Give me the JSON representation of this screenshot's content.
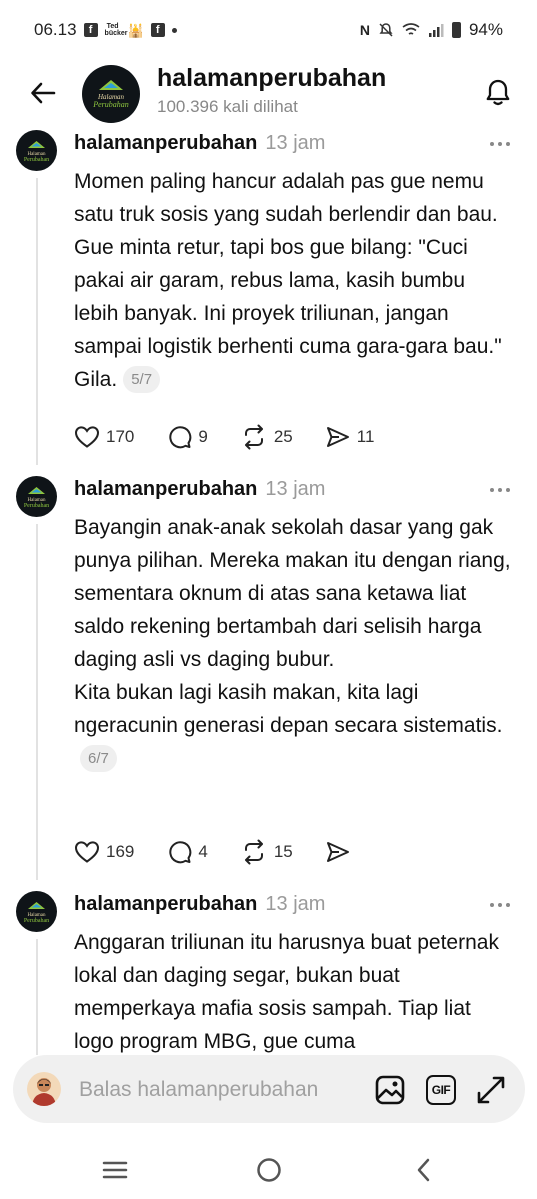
{
  "status": {
    "time": "06.13",
    "notif_small": "Ted\nbücker",
    "battery": "94%"
  },
  "header": {
    "title": "halamanperubahan",
    "subtitle": "100.396 kali dilihat",
    "logo_text": "Halaman Perubahan"
  },
  "posts": [
    {
      "author": "halamanperubahan",
      "time": "13 jam",
      "text": "Momen paling hancur adalah pas gue nemu satu truk sosis yang sudah berlendir dan bau. Gue minta retur, tapi bos gue bilang: \"Cuci pakai air garam, rebus lama, kasih bumbu lebih banyak. Ini proyek triliunan, jangan sampai logistik berhenti cuma gara-gara bau.\" Gila.",
      "page": "5/7",
      "likes": "170",
      "comments": "9",
      "reposts": "25",
      "shares": "11"
    },
    {
      "author": "halamanperubahan",
      "time": "13 jam",
      "text": "Bayangin anak-anak sekolah dasar yang gak punya pilihan. Mereka makan itu dengan riang, sementara oknum di atas sana ketawa liat saldo rekening bertambah dari selisih harga daging asli vs daging bubur.\nKita bukan lagi kasih makan, kita lagi ngeracunin generasi depan secara sistematis.",
      "page": "6/7",
      "likes": "169",
      "comments": "4",
      "reposts": "15",
      "shares": ""
    },
    {
      "author": "halamanperubahan",
      "time": "13 jam",
      "text": "Anggaran triliunan itu harusnya buat peternak lokal dan daging segar, bukan buat memperkaya mafia sosis sampah. Tiap liat logo program MBG, gue cuma"
    }
  ],
  "reply": {
    "placeholder": "Balas halamanperubahan"
  },
  "icons": {
    "back": "arrow-left-icon",
    "bell": "bell-icon",
    "like": "heart-icon",
    "comment": "comment-icon",
    "repost": "repost-icon",
    "share": "send-icon",
    "more": "more-icon",
    "image": "image-icon",
    "gif": "gif-icon",
    "expand": "expand-icon"
  }
}
